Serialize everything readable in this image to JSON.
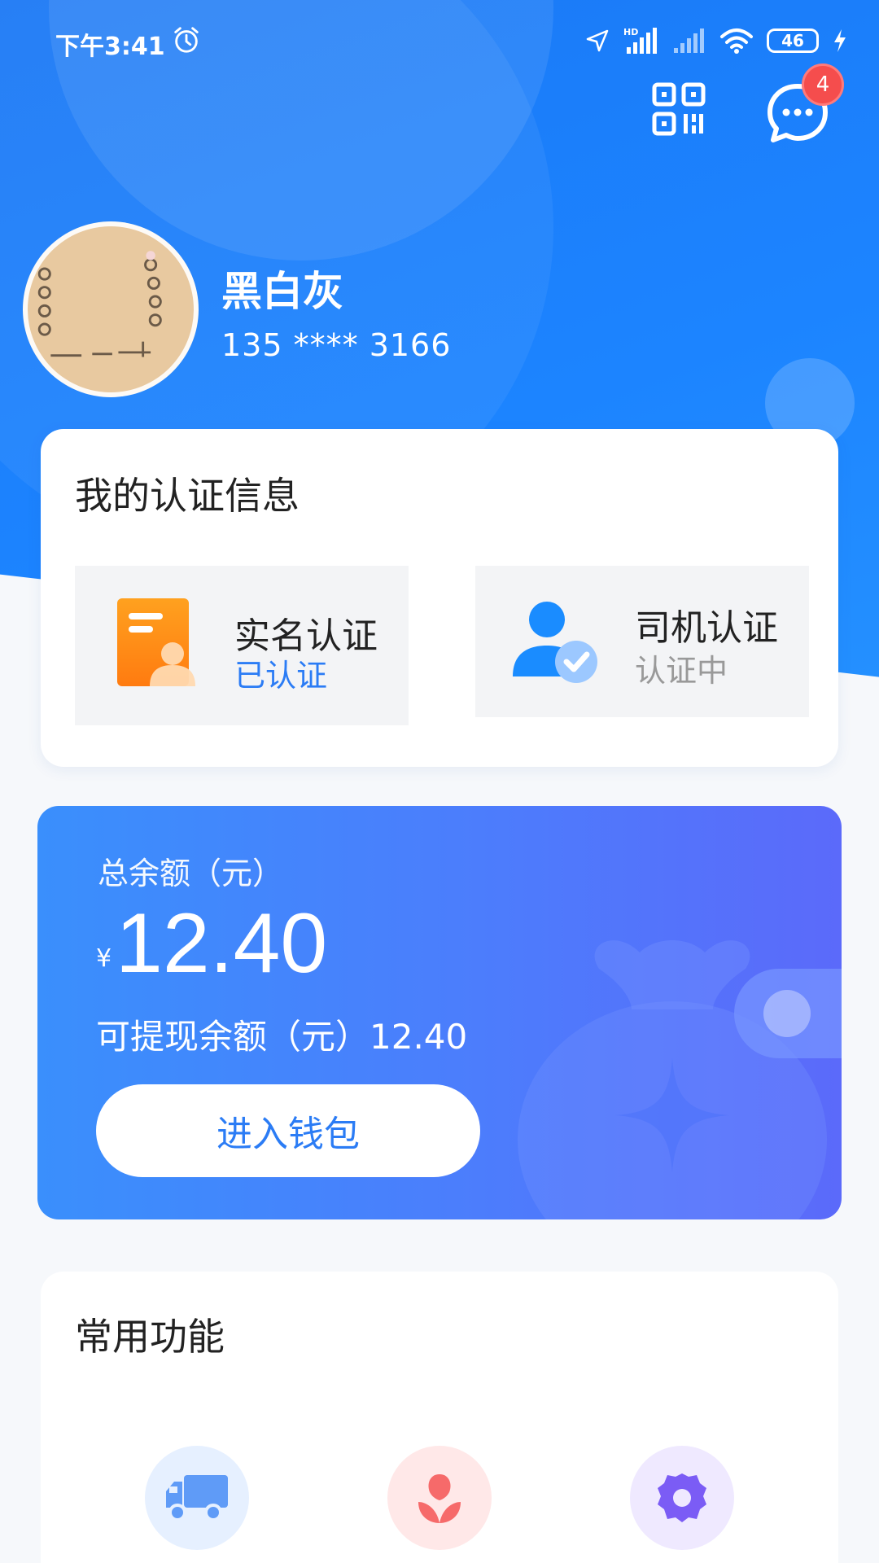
{
  "status_bar": {
    "time": "下午3:41",
    "battery": "46",
    "icons": [
      "alarm-icon",
      "location-icon",
      "signal-hd-icon",
      "signal-icon",
      "wifi-icon",
      "battery-icon",
      "charging-icon"
    ]
  },
  "header": {
    "message_badge": "4",
    "icons": [
      "qr-code-icon",
      "message-icon"
    ]
  },
  "profile": {
    "name": "黑白灰",
    "phone": "135 **** 3166"
  },
  "auth_card": {
    "title": "我的认证信息",
    "items": [
      {
        "label": "实名认证",
        "status": "已认证",
        "status_color": "#2b7cf5",
        "icon": "id-card-icon"
      },
      {
        "label": "司机认证",
        "status": "认证中",
        "status_color": "#999999",
        "icon": "driver-verify-icon"
      }
    ]
  },
  "wallet": {
    "total_label": "总余额（元）",
    "currency": "¥",
    "total_amount": "12.40",
    "withdrawable_label": "可提现余额（元）12.40",
    "button_label": "进入钱包"
  },
  "functions": {
    "title": "常用功能",
    "items": [
      {
        "icon": "truck-icon"
      },
      {
        "icon": "flower-icon"
      },
      {
        "icon": "settings-gear-icon"
      }
    ]
  },
  "colors": {
    "primary": "#1c84ff",
    "badge": "#f54d4d",
    "wallet_start": "#3a8ffc",
    "wallet_end": "#5b6afa"
  }
}
